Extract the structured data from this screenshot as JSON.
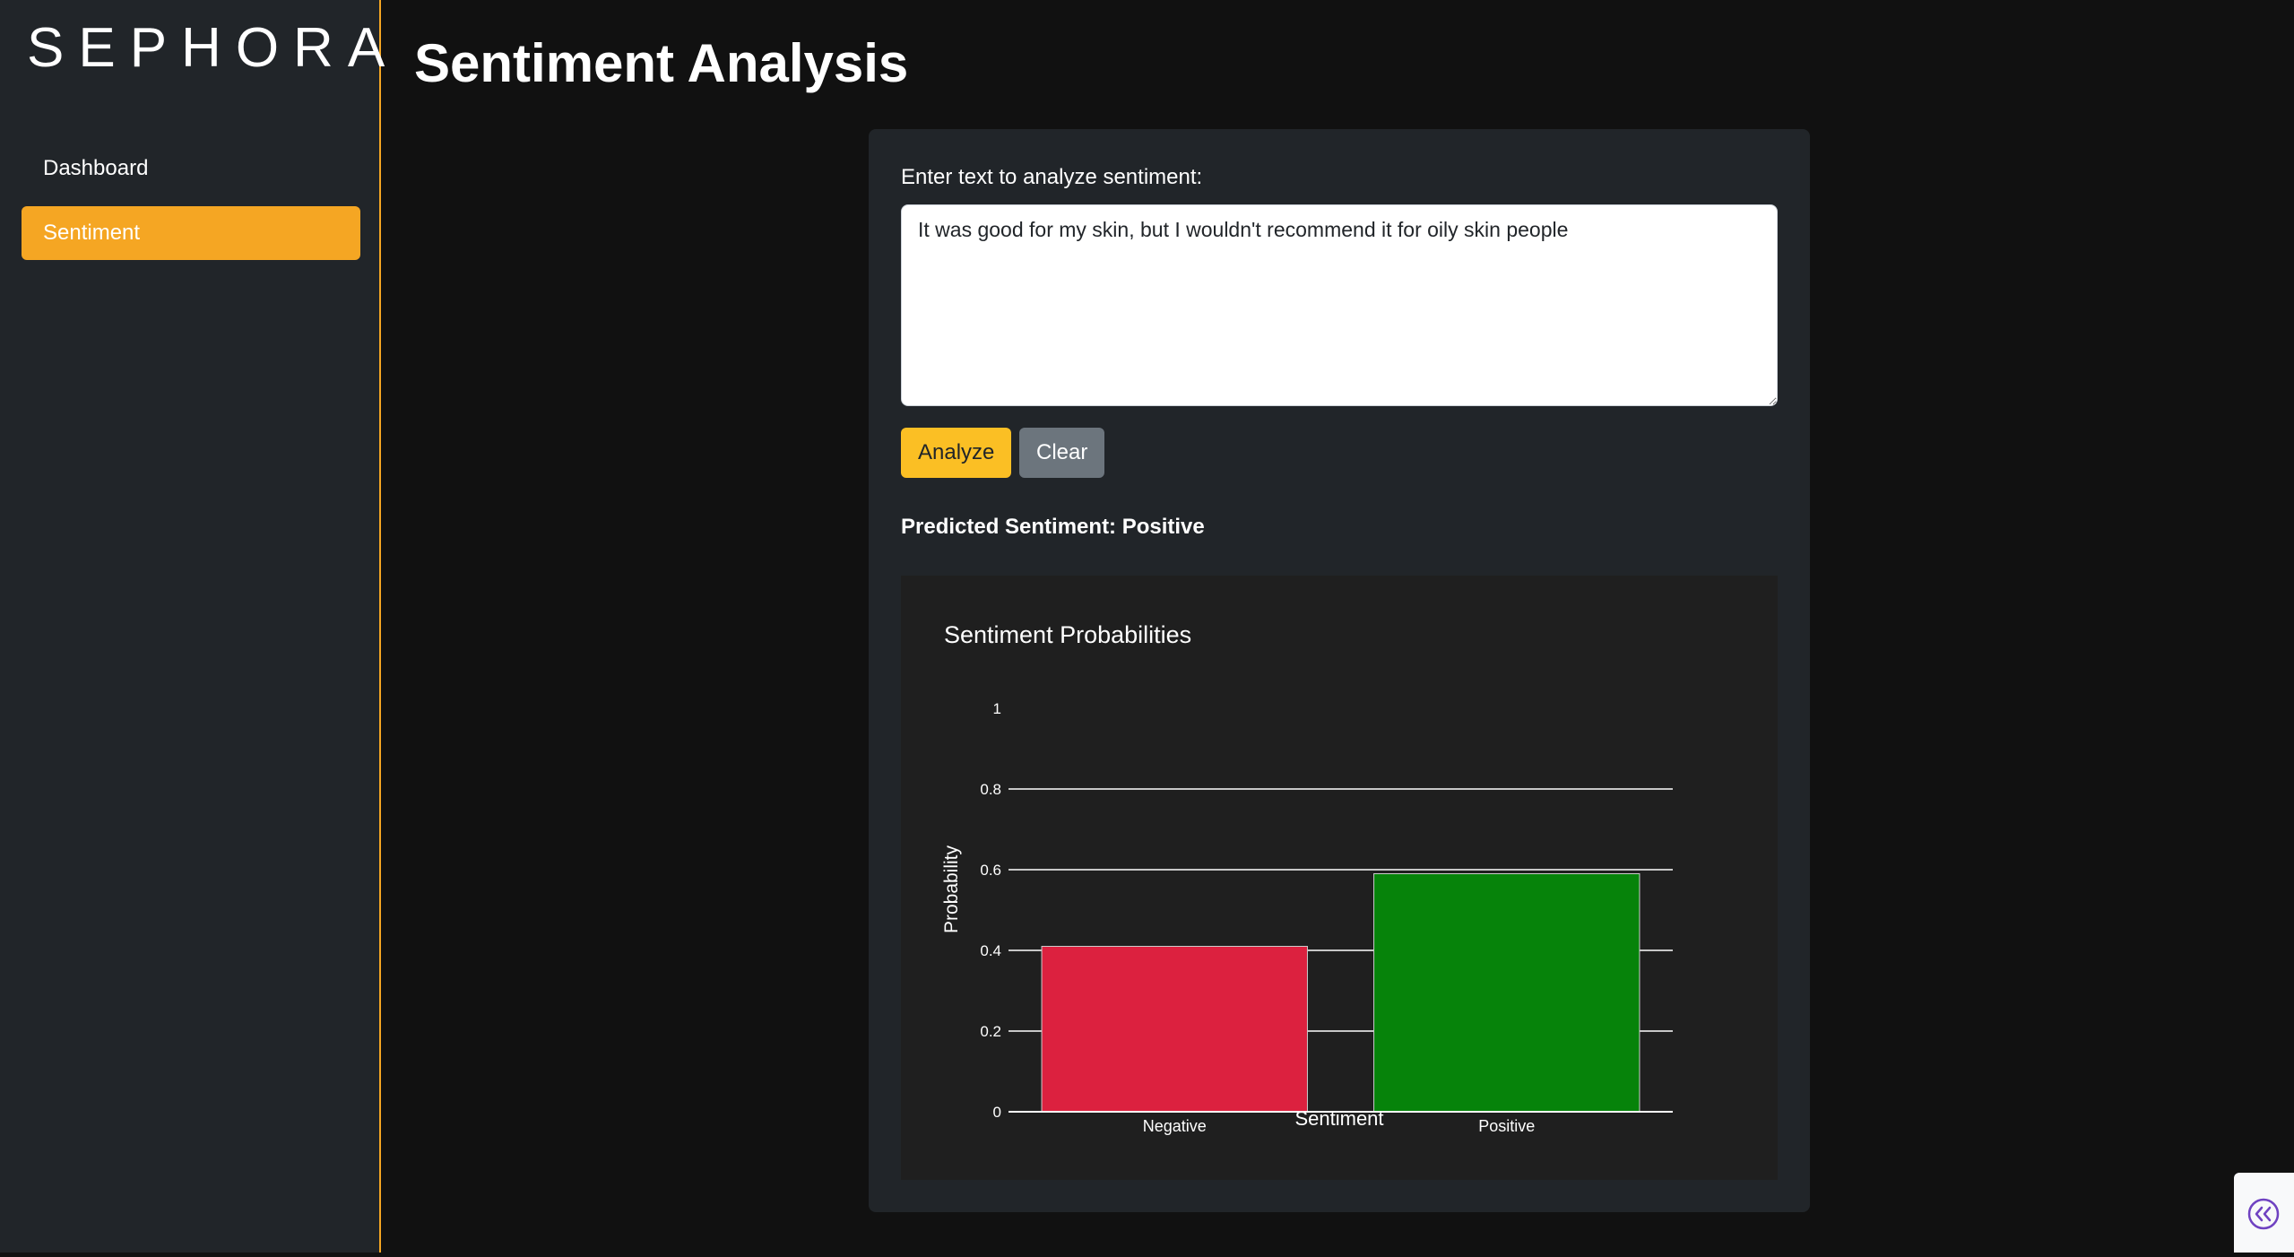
{
  "sidebar": {
    "logo": "SEPHORA",
    "items": [
      {
        "label": "Dashboard",
        "active": false
      },
      {
        "label": "Sentiment",
        "active": true
      }
    ]
  },
  "page": {
    "title": "Sentiment Analysis"
  },
  "form": {
    "label": "Enter text to analyze sentiment:",
    "text_value": "It was good for my skin, but I wouldn't recommend it for oily skin people",
    "analyze_label": "Analyze",
    "clear_label": "Clear"
  },
  "result": {
    "predicted": "Predicted Sentiment: Positive"
  },
  "colors": {
    "accent": "#f5a623",
    "analyze": "#fbbf24",
    "negative": "#dc213f",
    "positive": "#06830a"
  },
  "corner": {
    "icon": "double-chevron-left-icon"
  },
  "chart_data": {
    "type": "bar",
    "title": "Sentiment Probabilities",
    "xlabel": "Sentiment",
    "ylabel": "Probability",
    "categories": [
      "Negative",
      "Positive"
    ],
    "values": [
      0.41,
      0.59
    ],
    "bar_colors": [
      "#dc213f",
      "#06830a"
    ],
    "ylim": [
      0,
      1
    ],
    "yticks": [
      0,
      0.2,
      0.4,
      0.6,
      0.8,
      1
    ],
    "ytick_labels": [
      "0",
      "0.2",
      "0.4",
      "0.6",
      "0.8",
      "1"
    ],
    "grid": true
  }
}
